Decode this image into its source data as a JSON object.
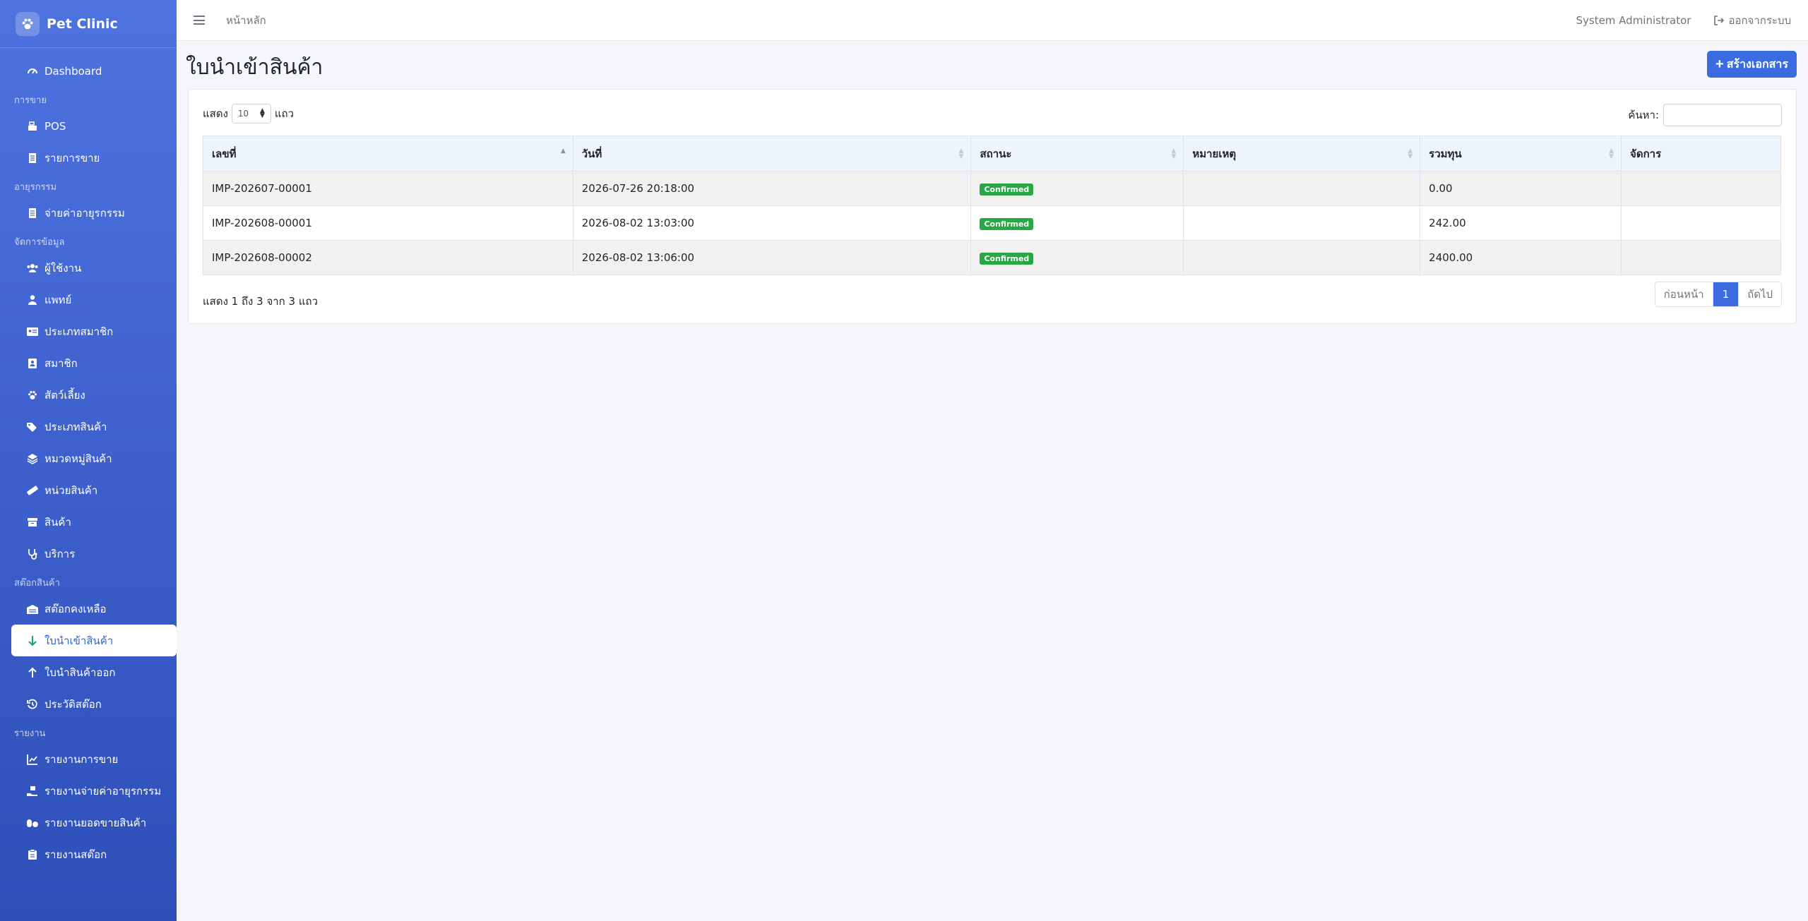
{
  "brand": {
    "name": "Pet Clinic"
  },
  "sidebar": {
    "dashboard": "Dashboard",
    "sections": [
      {
        "label": "การขาย",
        "items": [
          {
            "label": "POS",
            "icon": "cash-register-icon"
          },
          {
            "label": "รายการขาย",
            "icon": "receipt-icon"
          }
        ]
      },
      {
        "label": "อายุรกรรม",
        "items": [
          {
            "label": "จ่ายค่าอายุรกรรม",
            "icon": "receipt-icon"
          }
        ]
      },
      {
        "label": "จัดการข้อมูล",
        "items": [
          {
            "label": "ผู้ใช้งาน",
            "icon": "users-icon"
          },
          {
            "label": "แพทย์",
            "icon": "doctor-icon"
          },
          {
            "label": "ประเภทสมาชิก",
            "icon": "id-card-icon"
          },
          {
            "label": "สมาชิก",
            "icon": "address-book-icon"
          },
          {
            "label": "สัตว์เลี้ยง",
            "icon": "paw-icon"
          },
          {
            "label": "ประเภทสินค้า",
            "icon": "tags-icon"
          },
          {
            "label": "หมวดหมู่สินค้า",
            "icon": "layers-icon"
          },
          {
            "label": "หน่วยสินค้า",
            "icon": "ruler-icon"
          },
          {
            "label": "สินค้า",
            "icon": "box-icon"
          },
          {
            "label": "บริการ",
            "icon": "stethoscope-icon"
          }
        ]
      },
      {
        "label": "สต๊อกสินค้า",
        "items": [
          {
            "label": "สต๊อกคงเหลือ",
            "icon": "warehouse-icon"
          },
          {
            "label": "ใบนำเข้าสินค้า",
            "icon": "arrow-down-icon",
            "active": true
          },
          {
            "label": "ใบนำสินค้าออก",
            "icon": "arrow-up-icon"
          },
          {
            "label": "ประวัติสต๊อก",
            "icon": "history-icon"
          }
        ]
      },
      {
        "label": "รายงาน",
        "items": [
          {
            "label": "รายงานการขาย",
            "icon": "chart-line-icon"
          },
          {
            "label": "รายงานจ่ายค่าอายุรกรรม",
            "icon": "hand-money-icon"
          },
          {
            "label": "รายงานยอดขายสินค้า",
            "icon": "pills-icon"
          },
          {
            "label": "รายงานสต๊อก",
            "icon": "clipboard-icon"
          }
        ]
      }
    ]
  },
  "topbar": {
    "breadcrumb": "หน้าหลัก",
    "user": "System Administrator",
    "logout": "ออกจากระบบ"
  },
  "page": {
    "title": "ใบนำเข้าสินค้า",
    "create_label": "สร้างเอกสาร"
  },
  "table_controls": {
    "show_prefix": "แสดง",
    "page_length": "10",
    "show_suffix": "แถว",
    "search_label": "ค้นหา:"
  },
  "table": {
    "columns": [
      "เลขที่",
      "วันที่",
      "สถานะ",
      "หมายเหตุ",
      "รวมทุน",
      "จัดการ"
    ],
    "rows": [
      [
        "IMP-202607-00001",
        "2026-07-26 20:18:00",
        "Confirmed",
        "",
        "0.00",
        ""
      ],
      [
        "IMP-202608-00001",
        "2026-08-02 13:03:00",
        "Confirmed",
        "",
        "242.00",
        ""
      ],
      [
        "IMP-202608-00002",
        "2026-08-02 13:06:00",
        "Confirmed",
        "",
        "2400.00",
        ""
      ]
    ]
  },
  "footer": {
    "info": "แสดง 1 ถึง 3 จาก 3 แถว",
    "prev": "ก่อนหน้า",
    "current_page": "1",
    "next": "ถัดไป"
  },
  "colors": {
    "sidebar": "#4e73df",
    "primary": "#3b6be0",
    "badge_success": "#28a745"
  }
}
